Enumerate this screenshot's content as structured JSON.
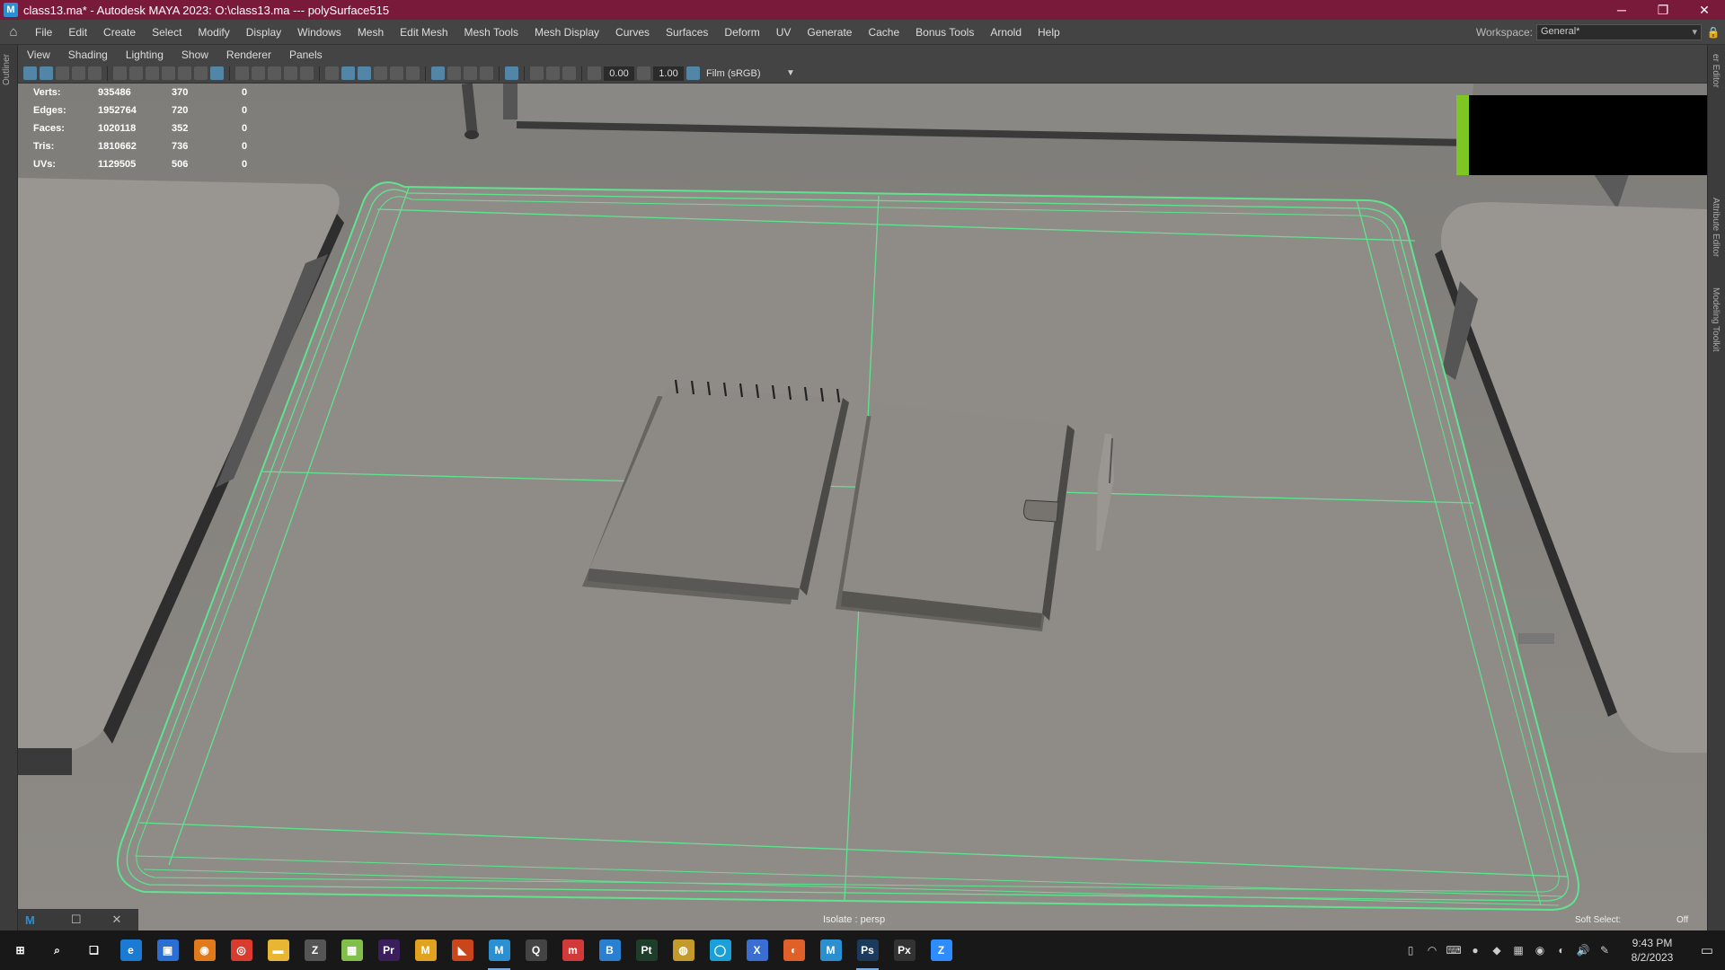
{
  "window": {
    "title": "class13.ma* - Autodesk MAYA 2023: O:\\class13.ma  ---  polySurface515",
    "app_icon": "M",
    "minimize": "─",
    "maximize": "❐",
    "close": "✕"
  },
  "menubar": {
    "items": [
      "File",
      "Edit",
      "Create",
      "Select",
      "Modify",
      "Display",
      "Windows",
      "Mesh",
      "Edit Mesh",
      "Mesh Tools",
      "Mesh Display",
      "Curves",
      "Surfaces",
      "Deform",
      "UV",
      "Generate",
      "Cache",
      "Bonus Tools",
      "Arnold",
      "Help"
    ],
    "workspace_label": "Workspace:",
    "workspace_value": "General*"
  },
  "side_tabs": {
    "left": "Outliner",
    "right": [
      "er Editor",
      "Attribute Editor",
      "Modeling Toolkit"
    ]
  },
  "panel_menu": [
    "View",
    "Shading",
    "Lighting",
    "Show",
    "Renderer",
    "Panels"
  ],
  "viewport_toolbar": {
    "exposure": "0.00",
    "gamma": "1.00",
    "color_space": "Film (sRGB)"
  },
  "hud": {
    "rows": [
      {
        "label": "Verts:",
        "v1": "935486",
        "v2": "370",
        "v3": "0"
      },
      {
        "label": "Edges:",
        "v1": "1952764",
        "v2": "720",
        "v3": "0"
      },
      {
        "label": "Faces:",
        "v1": "1020118",
        "v2": "352",
        "v3": "0"
      },
      {
        "label": "Tris:",
        "v1": "1810662",
        "v2": "736",
        "v3": "0"
      },
      {
        "label": "UVs:",
        "v1": "1129505",
        "v2": "506",
        "v3": "0"
      }
    ],
    "camera": "Isolate : persp",
    "soft_select_label": "Soft Select:",
    "soft_select_value": "Off"
  },
  "mini_window": {
    "icon": "M",
    "restore": "☐",
    "close": "✕"
  },
  "taskbar": {
    "apps": [
      {
        "name": "start",
        "glyph": "⊞",
        "color": "#181818"
      },
      {
        "name": "search",
        "glyph": "⌕",
        "color": "#181818"
      },
      {
        "name": "task-view",
        "glyph": "❏",
        "color": "#181818"
      },
      {
        "name": "edge",
        "glyph": "e",
        "color": "#1b7ad1"
      },
      {
        "name": "store",
        "glyph": "▣",
        "color": "#2a6fd1"
      },
      {
        "name": "blender",
        "glyph": "◉",
        "color": "#e07a1a"
      },
      {
        "name": "chrome",
        "glyph": "◎",
        "color": "#d93c2f"
      },
      {
        "name": "explorer",
        "glyph": "▬",
        "color": "#e8b632"
      },
      {
        "name": "zbrush",
        "glyph": "Z",
        "color": "#555555"
      },
      {
        "name": "maps",
        "glyph": "▦",
        "color": "#7fbf4a"
      },
      {
        "name": "premiere",
        "glyph": "Pr",
        "color": "#3a1f5c"
      },
      {
        "name": "marmoset",
        "glyph": "M",
        "color": "#e0a320"
      },
      {
        "name": "fusion",
        "glyph": "◣",
        "color": "#c9451c"
      },
      {
        "name": "maya",
        "glyph": "M",
        "color": "#2b8fd0"
      },
      {
        "name": "tool-q",
        "glyph": "Q",
        "color": "#444444"
      },
      {
        "name": "mudbox",
        "glyph": "m",
        "color": "#d23a3a"
      },
      {
        "name": "tool-b",
        "glyph": "B",
        "color": "#2a7fd1"
      },
      {
        "name": "painter",
        "glyph": "Pt",
        "color": "#1f3d2b"
      },
      {
        "name": "globe",
        "glyph": "◍",
        "color": "#c49a2a"
      },
      {
        "name": "tool-o",
        "glyph": "◯",
        "color": "#1aa0d8"
      },
      {
        "name": "tool-x",
        "glyph": "X",
        "color": "#3a6fd1"
      },
      {
        "name": "houdini",
        "glyph": "◐",
        "color": "#e0602a"
      },
      {
        "name": "maya-2",
        "glyph": "M",
        "color": "#2b8fd0"
      },
      {
        "name": "photoshop",
        "glyph": "Ps",
        "color": "#1b3a5c"
      },
      {
        "name": "px",
        "glyph": "Px",
        "color": "#333333"
      },
      {
        "name": "zoom",
        "glyph": "Z",
        "color": "#2d8cff"
      }
    ],
    "tray_icons": [
      "▯",
      "◠",
      "⌨",
      "●",
      "◆",
      "▦",
      "◉",
      "◐",
      "🔊",
      "✎"
    ],
    "time": "9:43 PM",
    "date": "8/2/2023",
    "notification": "▭"
  }
}
